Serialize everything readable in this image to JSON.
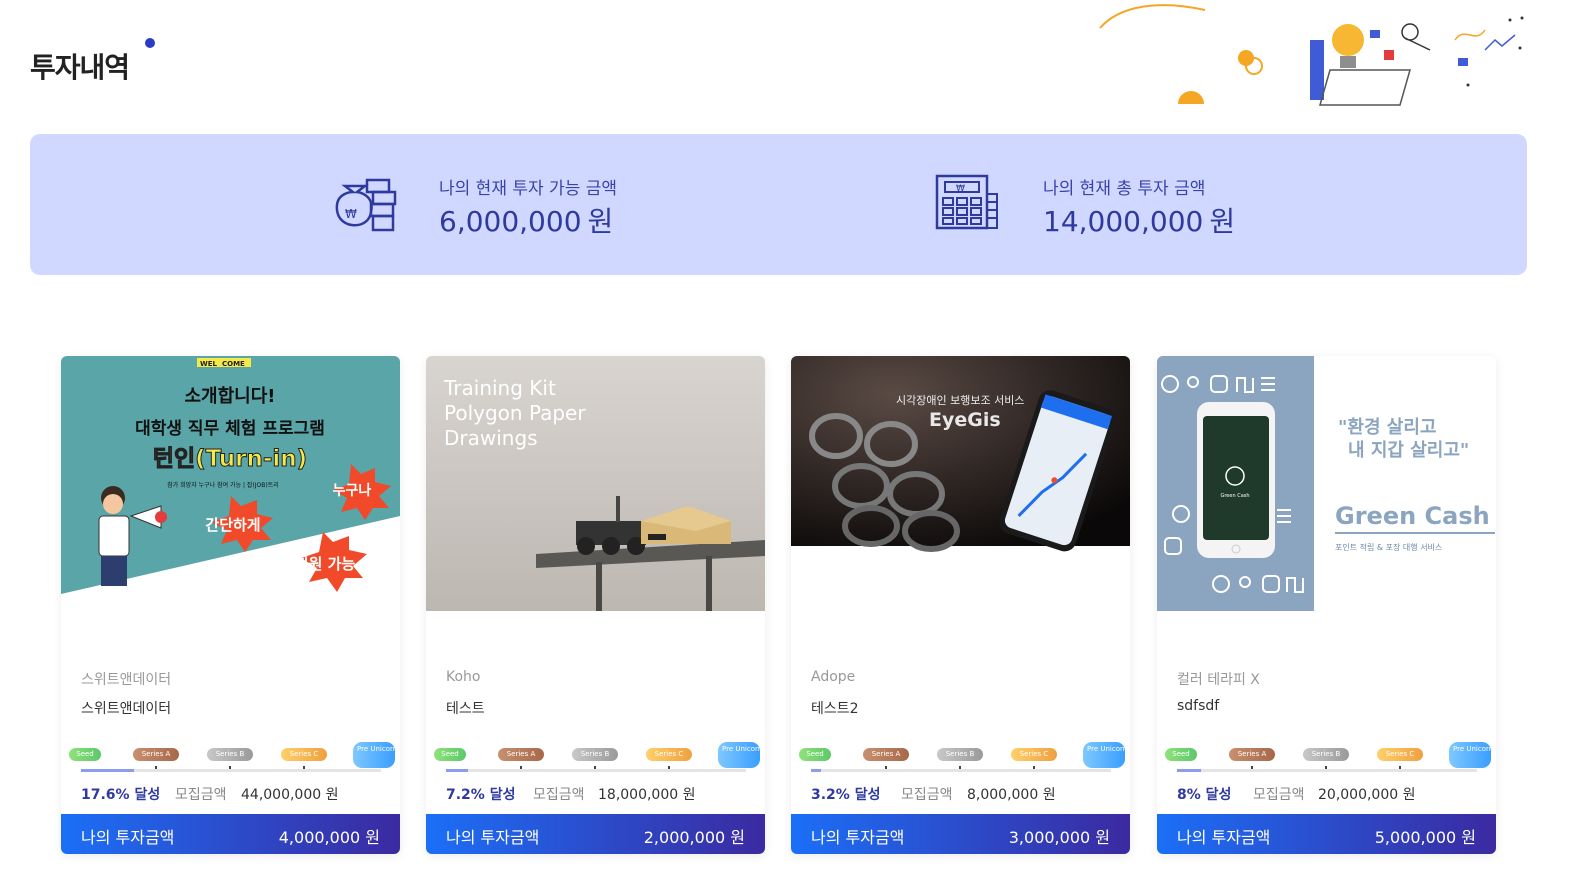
{
  "page": {
    "title": "투자내역"
  },
  "summary": {
    "available": {
      "label": "나의 현재 투자 가능 금액",
      "amount": "6,000,000",
      "unit": "원",
      "icon": "money-bag-icon"
    },
    "total": {
      "label": "나의 현재 총 투자 금액",
      "amount": "14,000,000",
      "unit": "원",
      "icon": "calculator-icon"
    }
  },
  "stages": [
    "Seed",
    "Series A",
    "Series B",
    "Series C",
    "Pre Unicorn"
  ],
  "goal_label": "모집금액",
  "my_invest_label": "나의 투자금액",
  "cards": [
    {
      "company": "스위트앤데이터",
      "project": "스위트앤데이터",
      "percent_text": "17.6% 달성",
      "progress": 0.176,
      "goal_amount": "44,000,000 원",
      "my_amount": "4,000,000 원",
      "image": {
        "badge_left": "WEL",
        "badge_right": "COME",
        "line1": "소개합니다!",
        "line2": "대학생 직무 체험 프로그램",
        "line3": "턴인(Turn-in)",
        "line4": "참가 희망자 누구나 참여 가능 | 잡(JOB)트리",
        "burst1": "누구나",
        "burst2": "간단하게",
        "burst3": "지원 가능"
      }
    },
    {
      "company": "Koho",
      "project": "테스트",
      "percent_text": "7.2% 달성",
      "progress": 0.072,
      "goal_amount": "18,000,000 원",
      "my_amount": "2,000,000 원",
      "image": {
        "line1": "Training Kit",
        "line2": "Polygon Paper",
        "line3": "Drawings"
      }
    },
    {
      "company": "Adope",
      "project": "테스트2",
      "percent_text": "3.2% 달성",
      "progress": 0.032,
      "goal_amount": "8,000,000 원",
      "my_amount": "3,000,000 원",
      "image": {
        "line1": "시각장애인 보행보조 서비스",
        "line2": "EyeGis"
      }
    },
    {
      "company": "컬러 테라피 X",
      "project": "sdfsdf",
      "percent_text": "8% 달성",
      "progress": 0.08,
      "goal_amount": "20,000,000 원",
      "my_amount": "5,000,000 원",
      "image": {
        "quote1": "\"환경 살리고",
        "quote2": "내 지갑 살리고\"",
        "brand": "Green Cash",
        "sub": "포인트 적립 & 포장 대행 서비스",
        "phone_brand": "Green Cash"
      }
    }
  ]
}
